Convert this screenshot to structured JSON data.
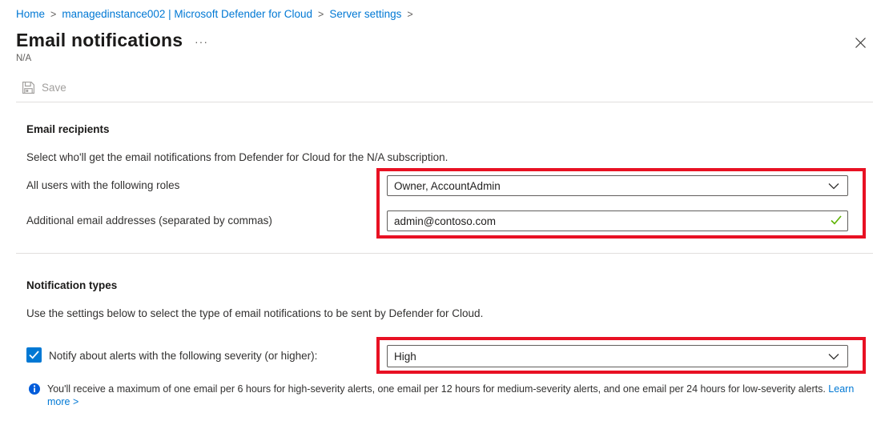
{
  "breadcrumb": {
    "separator": ">",
    "items": [
      {
        "label": "Home"
      },
      {
        "label": "managedinstance002 | Microsoft Defender for Cloud"
      },
      {
        "label": "Server settings"
      }
    ]
  },
  "header": {
    "title": "Email notifications",
    "more_label": "···",
    "subtitle": "N/A"
  },
  "toolbar": {
    "save_label": "Save"
  },
  "email_recipients": {
    "heading": "Email recipients",
    "description": "Select who'll get the email notifications from Defender for Cloud for the N/A subscription.",
    "roles_label": "All users with the following roles",
    "roles_value": "Owner, AccountAdmin",
    "emails_label": "Additional email addresses (separated by commas)",
    "emails_value": "admin@contoso.com"
  },
  "notification_types": {
    "heading": "Notification types",
    "description": "Use the settings below to select the type of email notifications to be sent by Defender for Cloud.",
    "checkbox_checked": true,
    "severity_label": "Notify about alerts with the following severity (or higher):",
    "severity_value": "High"
  },
  "info": {
    "text": "You'll receive a maximum of one email per 6 hours for high-severity alerts, one email per 12 hours for medium-severity alerts, and one email per 24 hours for low-severity alerts.",
    "link_label": "Learn more >"
  },
  "colors": {
    "link_blue": "#0078d4",
    "annotation_red": "#e81123",
    "checkbox_blue": "#0078d4",
    "valid_green": "#5db300",
    "info_blue": "#015cda",
    "disabled_gray": "#a19f9d"
  }
}
